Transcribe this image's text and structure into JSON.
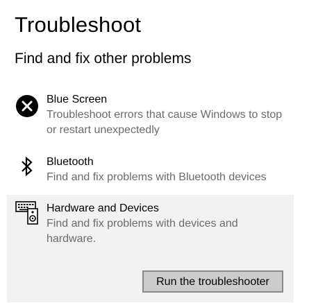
{
  "page": {
    "title": "Troubleshoot",
    "section_title": "Find and fix other problems"
  },
  "items": [
    {
      "icon": "error-circle-icon",
      "name": "Blue Screen",
      "description": "Troubleshoot errors that cause Windows to stop or restart unexpectedly"
    },
    {
      "icon": "bluetooth-icon",
      "name": "Bluetooth",
      "description": "Find and fix problems with Bluetooth devices"
    },
    {
      "icon": "hardware-devices-icon",
      "name": "Hardware and Devices",
      "description": "Find and fix problems with devices and hardware.",
      "selected": true,
      "button_label": "Run the troubleshooter"
    }
  ],
  "colors": {
    "selected_background": "#f2f2f2",
    "description_text": "#6b6b6b",
    "button_background": "#cccccc",
    "button_border": "#8a8a8a"
  }
}
